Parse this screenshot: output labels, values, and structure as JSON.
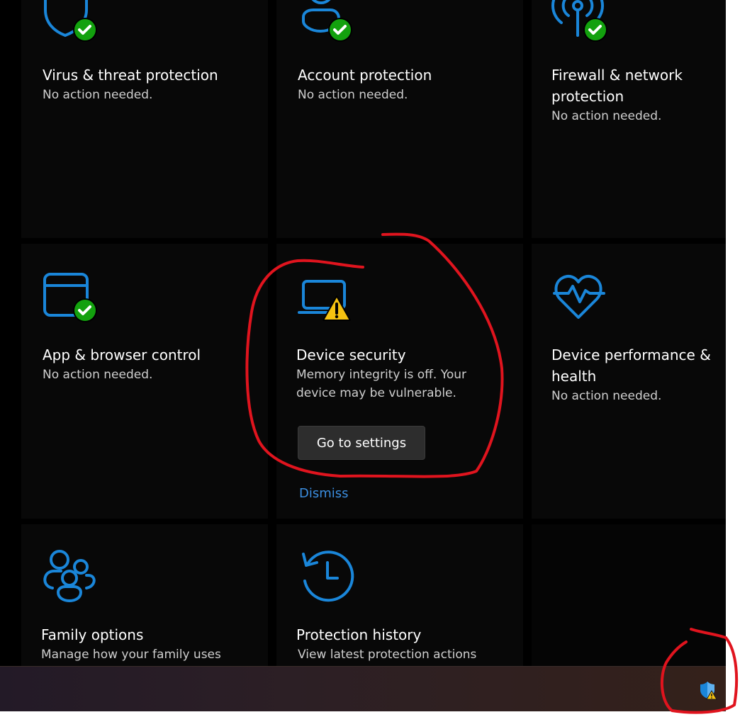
{
  "tiles": {
    "virus": {
      "title": "Virus & threat protection",
      "desc": "No action needed.",
      "icon": "shield-icon",
      "status": "ok"
    },
    "account": {
      "title": "Account protection",
      "desc": "No action needed.",
      "icon": "person-icon",
      "status": "ok"
    },
    "firewall": {
      "title": "Firewall & network protection",
      "desc": "No action needed.",
      "icon": "wifi-antenna-icon",
      "status": "ok"
    },
    "app_browser": {
      "title": "App & browser control",
      "desc": "No action needed.",
      "icon": "app-window-icon",
      "status": "ok"
    },
    "device_security": {
      "title": "Device security",
      "desc": "Memory integrity is off. Your device may be vulnerable.",
      "icon": "laptop-icon",
      "status": "warning",
      "button_label": "Go to settings",
      "dismiss_label": "Dismiss"
    },
    "performance": {
      "title": "Device performance & health",
      "desc": "No action needed.",
      "icon": "heartbeat-icon",
      "status": "ok"
    },
    "family": {
      "title": "Family options",
      "desc": "Manage how your family uses",
      "icon": "family-icon"
    },
    "history": {
      "title": "Protection history",
      "desc": "View latest protection actions",
      "icon": "history-clock-icon"
    }
  },
  "taskbar": {
    "tray_icon": "defender-shield-warning-icon"
  },
  "colors": {
    "accent": "#1a86d9",
    "ok": "#13a10e",
    "warning": "#f5c211",
    "annotation": "#e0141e",
    "link": "#3b8ee0"
  }
}
